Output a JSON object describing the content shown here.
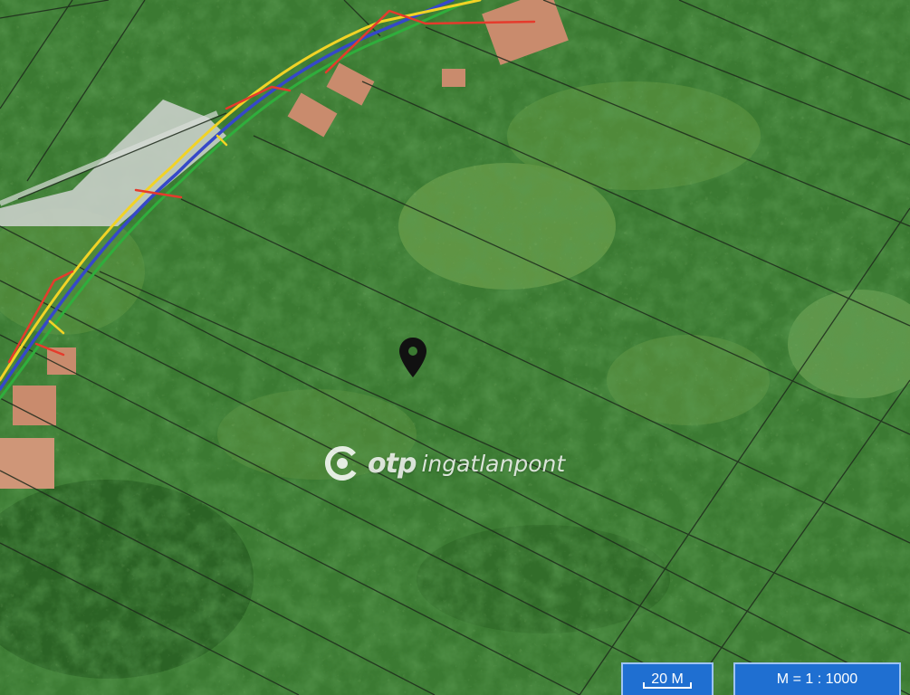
{
  "map": {
    "watermark": {
      "brand": "otp",
      "product": "ingatlanpont"
    },
    "marker": {
      "icon": "map-pin-icon"
    },
    "scale_bar": {
      "label": "20 M"
    },
    "scale_ratio": {
      "label": "M = 1 : 1000"
    },
    "colors": {
      "vegetation": "#2f6b2a",
      "parcel_line": "#1e2a1c",
      "road": "#c9cfc9",
      "roof": "#c98b6d",
      "utility_red": "#e53b2c",
      "utility_yellow": "#f2d325",
      "utility_blue": "#3548c9",
      "utility_green": "#2fae3c",
      "scale_bg": "#1f6fd1"
    }
  }
}
